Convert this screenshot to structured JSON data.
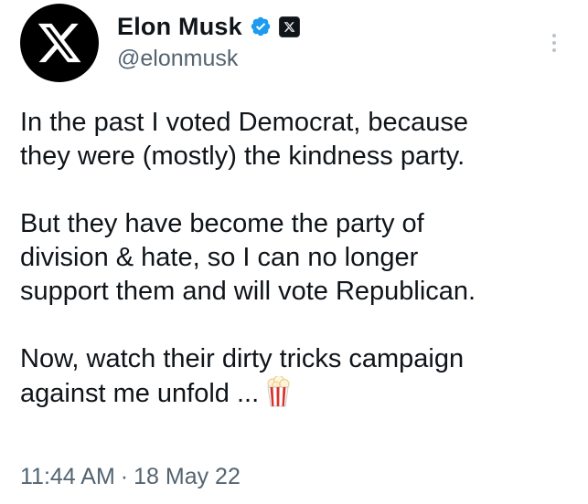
{
  "author": {
    "display_name": "Elon Musk",
    "handle": "@elonmusk",
    "verified": true,
    "avatar_icon": "x-logo-icon",
    "badge_icon": "x-affiliate-badge-icon"
  },
  "tweet": {
    "paragraphs": [
      {
        "lines": [
          "In the past I voted Democrat, because",
          "they were (mostly) the kindness party."
        ]
      },
      {
        "lines": [
          "But they have become the party of",
          "division & hate, so I can no longer",
          "support them and will vote Republican."
        ]
      },
      {
        "lines": [
          "Now, watch their dirty tricks campaign",
          "against me unfold ..."
        ],
        "trailing_emoji": "popcorn-icon"
      }
    ]
  },
  "meta": {
    "time": "11:44 AM",
    "separator": "·",
    "date": "18 May 22"
  },
  "colors": {
    "text": "#0f1419",
    "secondary": "#536471",
    "verified_blue": "#1d9bf0",
    "avatar_bg": "#000000"
  }
}
